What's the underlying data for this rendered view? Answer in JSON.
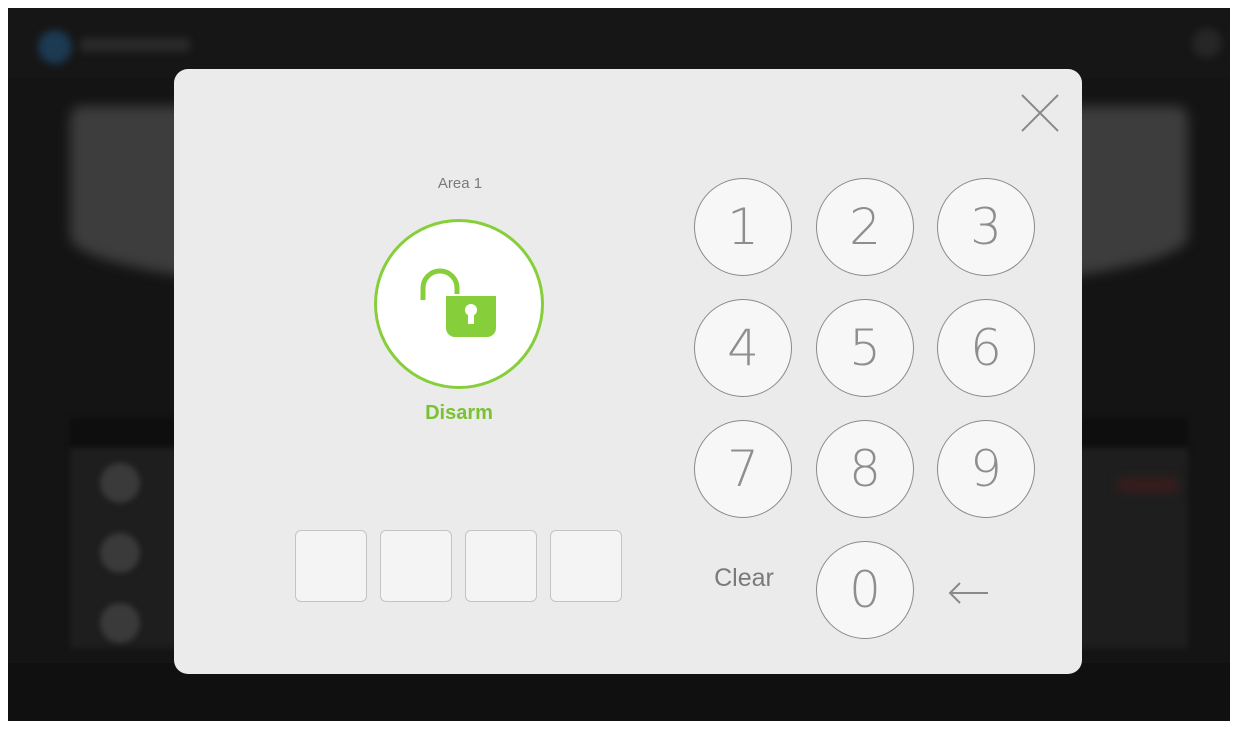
{
  "area": {
    "label": "Area 1"
  },
  "action": {
    "label": "Disarm",
    "icon": "unlocked-padlock-icon",
    "color": "#86cf3a"
  },
  "pin": {
    "slots": 4
  },
  "keypad": {
    "keys": [
      "1",
      "2",
      "3",
      "4",
      "5",
      "6",
      "7",
      "8",
      "9",
      "0"
    ],
    "clear_label": "Clear",
    "backspace_icon": "left-arrow-icon"
  },
  "modal": {
    "close_icon": "close-icon"
  }
}
